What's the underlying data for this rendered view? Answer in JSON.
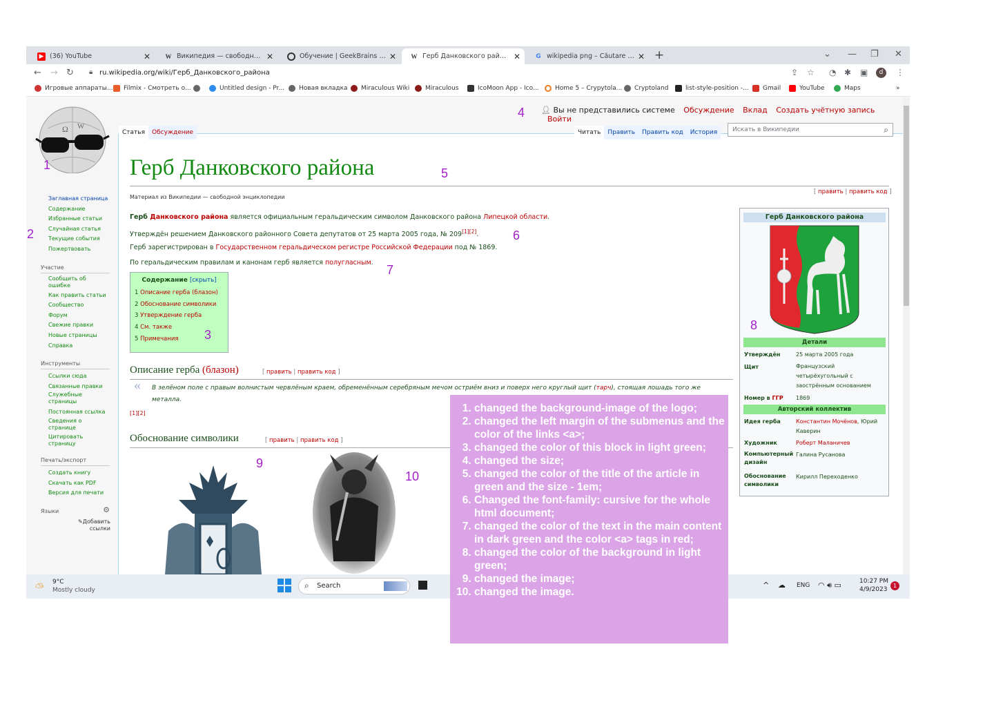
{
  "browser": {
    "tabs": [
      {
        "title": "(36) YouTube",
        "icon": "youtube-icon"
      },
      {
        "title": "Википедия — свободная энцик",
        "icon": "wikipedia-icon"
      },
      {
        "title": "Обучение | GeekBrains - образо",
        "icon": "geekbrains-icon"
      },
      {
        "title": "Герб Данковского района — Ви",
        "icon": "wikipedia-icon"
      },
      {
        "title": "wikipedia png – Căutare Google",
        "icon": "google-icon"
      }
    ],
    "url": "ru.wikipedia.org/wiki/Герб_Данковского_района",
    "bookmarks": [
      "Игровые аппараты...",
      "Filmix - Смотреть о...",
      "Untitled design - Pr...",
      "Новая вкладка",
      "Miraculous Wiki",
      "Miraculous",
      "IcoMoon App - Ico...",
      "Home 5 – Crypytola...",
      "Cryptoland",
      "list-style-position -...",
      "Gmail",
      "YouTube",
      "Maps"
    ],
    "profile_initial": "d"
  },
  "wiki": {
    "user_line": "Вы не представились системе",
    "user_links": [
      "Обсуждение",
      "Вклад",
      "Создать учётную запись",
      "Войти"
    ],
    "tabs_left": [
      "Статья",
      "Обсуждение"
    ],
    "tabs_right": [
      "Читать",
      "Править",
      "Править код",
      "История"
    ],
    "search_placeholder": "Искать в Википедии",
    "nav_main": [
      "Заглавная страница",
      "Содержание",
      "Избранные статьи",
      "Случайная статья",
      "Текущие события",
      "Пожертвовать"
    ],
    "nav_participation_head": "Участие",
    "nav_participation": [
      "Сообщить об ошибке",
      "Как править статьи",
      "Сообщество",
      "Форум",
      "Свежие правки",
      "Новые страницы",
      "Справка"
    ],
    "nav_tools_head": "Инструменты",
    "nav_tools": [
      "Ссылки сюда",
      "Связанные правки",
      "Служебные страницы",
      "Постоянная ссылка",
      "Сведения о странице",
      "Цитировать страницу"
    ],
    "nav_print_head": "Печать/экспорт",
    "nav_print": [
      "Создать книгу",
      "Скачать как PDF",
      "Версия для печати"
    ],
    "nav_lang_head": "Языки",
    "nav_add_links": "Добавить ссылки",
    "title": "Герб Данковского района",
    "subtitle": "Материал из Википедии — свободной энциклопедии",
    "edit_links": {
      "open": "[ ",
      "edit": "править",
      "sep": " | ",
      "edit_code": "править код",
      "close": " ]"
    },
    "p1": {
      "bold_a": "Герб ",
      "link_a": "Данковского района",
      "text": " является официальным геральдическим символом Данковского района ",
      "link_b": "Липецкой области",
      "end": "."
    },
    "p2": {
      "text": "Утверждён решением Данковского районного Совета депутатов от 25 марта 2005 года, № 209",
      "sup": "[1][2]",
      "end": "."
    },
    "p3": {
      "text": "Герб зарегистрирован в ",
      "link": "Государственном геральдическом регистре Российской Федерации",
      "end": " под № 1869."
    },
    "p4": {
      "text": "По геральдическим правилам и канонам герб является ",
      "link": "полугласным",
      "end": "."
    },
    "toc": {
      "title": "Содержание",
      "toggle": "[скрыть]",
      "items": [
        {
          "n": "1",
          "label": "Описание герба (блазон)"
        },
        {
          "n": "2",
          "label": "Обоснование символики"
        },
        {
          "n": "3",
          "label": "Утверждение герба"
        },
        {
          "n": "4",
          "label": "См. также"
        },
        {
          "n": "5",
          "label": "Примечания"
        }
      ]
    },
    "sec1": {
      "title": "Описание герба ",
      "title_link": "(блазон)"
    },
    "quote": {
      "text": "В зелёном поле с правым волнистым червлёным краем, обременённым серебряным мечом остриём вниз и поверх него круглый щит (",
      "link": "тарч",
      "end": "), стоящая лошадь того же металла."
    },
    "quote_refs": "[1][2]",
    "sec2": {
      "title": "Обоснование символики"
    },
    "infobox": {
      "title": "Герб Данковского района",
      "details_head": "Детали",
      "authors_head": "Авторский коллектив",
      "rows": [
        {
          "label": "Утверждён",
          "value": "25 марта 2005 года"
        },
        {
          "label": "Щит",
          "value": "Французский четырёхугольный с заострённым основанием"
        },
        {
          "label_text": "Номер в ",
          "label_link": "ГГР",
          "value": "1869"
        }
      ],
      "author_rows": [
        {
          "label": "Идея герба",
          "value_link": "Константин Мочёнов",
          "value_rest": ", Юрий Каверин"
        },
        {
          "label": "Художник",
          "value_link": "Роберт Маланичев",
          "value_rest": ""
        },
        {
          "label": "Компьютерный дизайн",
          "value_link": "",
          "value_rest": "Галина Русанова"
        },
        {
          "label": "Обоснование символики",
          "value_link": "",
          "value_rest": "Кирилл Переходенко"
        }
      ]
    }
  },
  "markers": [
    "1",
    "2",
    "3",
    "4",
    "5",
    "6",
    "7",
    "8",
    "9",
    "10"
  ],
  "taskbar": {
    "temp": "9°C",
    "weather": "Mostly cloudy",
    "search": "Search",
    "lang": "ENG",
    "time": "10:27 PM",
    "date": "4/9/2023",
    "notif": "1"
  },
  "annotation": [
    "changed the background-image of the logo;",
    "changed the left margin of the submenus and the color of the links <a>;",
    "changed the color of this block in light green;",
    "changed the size;",
    "changed the color of the title of the article in green and the size - 1em;",
    "Changed the font-family: cursive for the whole html document;",
    "changed the color of the text in the main content in dark green and the color <a> tags in red;",
    "changed the color of the background in light green;",
    "changed the image;",
    "changed the image."
  ],
  "colors": {
    "title_green": "#128a12",
    "link_red": "#ba0000",
    "toc_bg": "#bfffbf",
    "infobox_green": "#8ee68e",
    "annot_bg": "#dba4e6",
    "marker": "#a31fc9"
  }
}
